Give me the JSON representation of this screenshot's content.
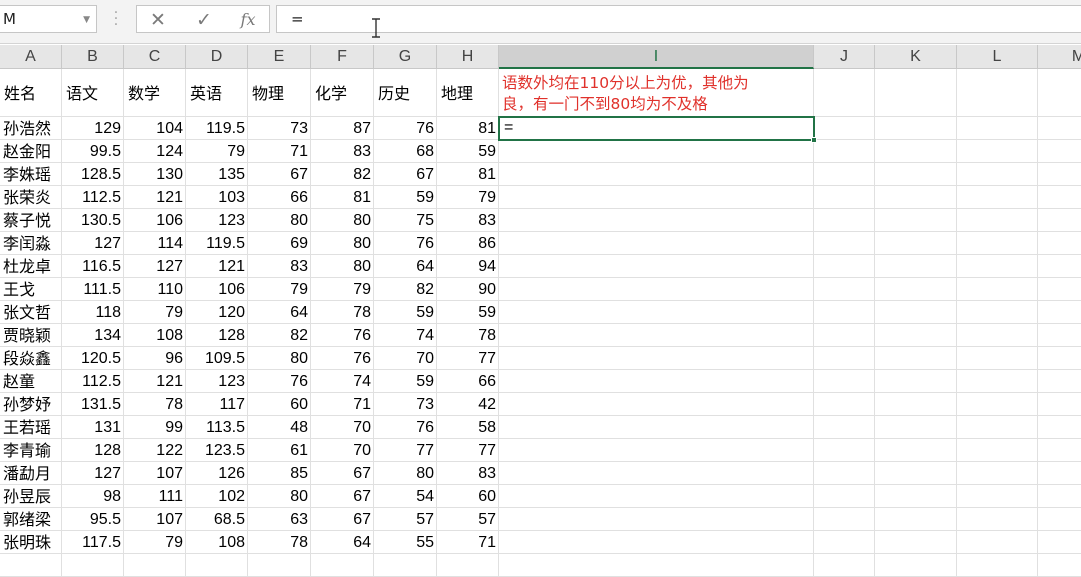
{
  "formula_bar": {
    "name_box": "M",
    "cancel_icon": "✕",
    "enter_icon": "✓",
    "fx_label": "fx",
    "formula": "="
  },
  "columns": [
    "A",
    "B",
    "C",
    "D",
    "E",
    "F",
    "G",
    "H",
    "I",
    "J",
    "K",
    "L",
    "M"
  ],
  "active_column": "I",
  "headers": [
    "姓名",
    "语文",
    "数学",
    "英语",
    "物理",
    "化学",
    "历史",
    "地理"
  ],
  "rows": [
    [
      "孙浩然",
      "129",
      "104",
      "119.5",
      "73",
      "87",
      "76",
      "81"
    ],
    [
      "赵金阳",
      "99.5",
      "124",
      "79",
      "71",
      "83",
      "68",
      "59"
    ],
    [
      "李姝瑶",
      "128.5",
      "130",
      "135",
      "67",
      "82",
      "67",
      "81"
    ],
    [
      "张荣炎",
      "112.5",
      "121",
      "103",
      "66",
      "81",
      "59",
      "79"
    ],
    [
      "蔡子悦",
      "130.5",
      "106",
      "123",
      "80",
      "80",
      "75",
      "83"
    ],
    [
      "李闰淼",
      "127",
      "114",
      "119.5",
      "69",
      "80",
      "76",
      "86"
    ],
    [
      "杜龙卓",
      "116.5",
      "127",
      "121",
      "83",
      "80",
      "64",
      "94"
    ],
    [
      "王戈",
      "111.5",
      "110",
      "106",
      "79",
      "79",
      "82",
      "90"
    ],
    [
      "张文哲",
      "118",
      "79",
      "120",
      "64",
      "78",
      "59",
      "59"
    ],
    [
      "贾晓颖",
      "134",
      "108",
      "128",
      "82",
      "76",
      "74",
      "78"
    ],
    [
      "段焱鑫",
      "120.5",
      "96",
      "109.5",
      "80",
      "76",
      "70",
      "77"
    ],
    [
      "赵童",
      "112.5",
      "121",
      "123",
      "76",
      "74",
      "59",
      "66"
    ],
    [
      "孙梦妤",
      "131.5",
      "78",
      "117",
      "60",
      "71",
      "73",
      "42"
    ],
    [
      "王若瑶",
      "131",
      "99",
      "113.5",
      "48",
      "70",
      "76",
      "58"
    ],
    [
      "李青瑜",
      "128",
      "122",
      "123.5",
      "61",
      "70",
      "77",
      "77"
    ],
    [
      "潘勐月",
      "127",
      "107",
      "126",
      "85",
      "67",
      "80",
      "83"
    ],
    [
      "孙昱辰",
      "98",
      "111",
      "102",
      "80",
      "67",
      "54",
      "60"
    ],
    [
      "郭绪梁",
      "95.5",
      "107",
      "68.5",
      "63",
      "67",
      "57",
      "57"
    ],
    [
      "张明珠",
      "117.5",
      "79",
      "108",
      "78",
      "64",
      "55",
      "71"
    ]
  ],
  "note": {
    "line1": "语数外均在110分以上为优，其他为",
    "line2": "良，有一门不到80均为不及格"
  },
  "active_cell_value": "=",
  "colors": {
    "accent": "#217346",
    "note": "#e0312b"
  }
}
